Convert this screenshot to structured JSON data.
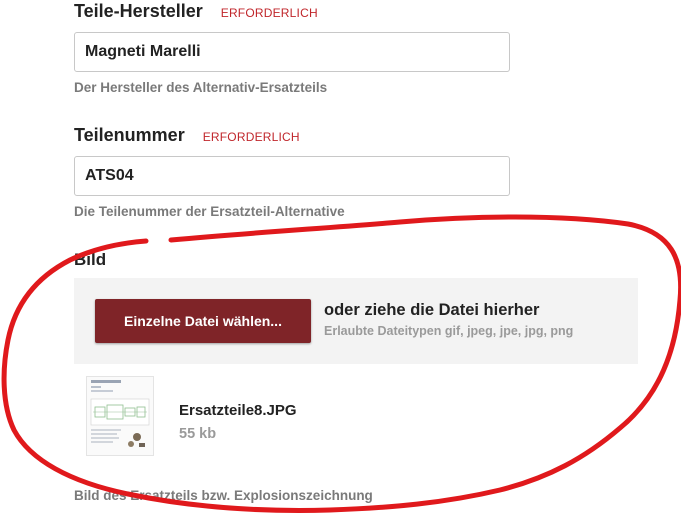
{
  "fields": [
    {
      "label": "Teile-Hersteller",
      "required_text": "ERFORDERLICH",
      "value": "Magneti Marelli",
      "hint": "Der Hersteller des Alternativ-Ersatzteils"
    },
    {
      "label": "Teilenummer",
      "required_text": "ERFORDERLICH",
      "value": "ATS04",
      "hint": "Die Teilenummer der Ersatzteil-Alternative"
    }
  ],
  "image_section": {
    "title": "Bild",
    "upload_button_label": "Einzelne Datei wählen...",
    "drop_text": "oder ziehe die Datei hierher",
    "allowed_types": "Erlaubte Dateitypen gif, jpeg, jpe, jpg, png",
    "file": {
      "name": "Ersatzteile8.JPG",
      "size": "55 kb"
    },
    "hint": "Bild des Ersatzteils bzw. Explosionszeichnung"
  },
  "colors": {
    "required": "#c0262b",
    "button": "#7f2428",
    "annotation": "#e0191c"
  },
  "icons": [
    "file-thumbnail-icon"
  ]
}
